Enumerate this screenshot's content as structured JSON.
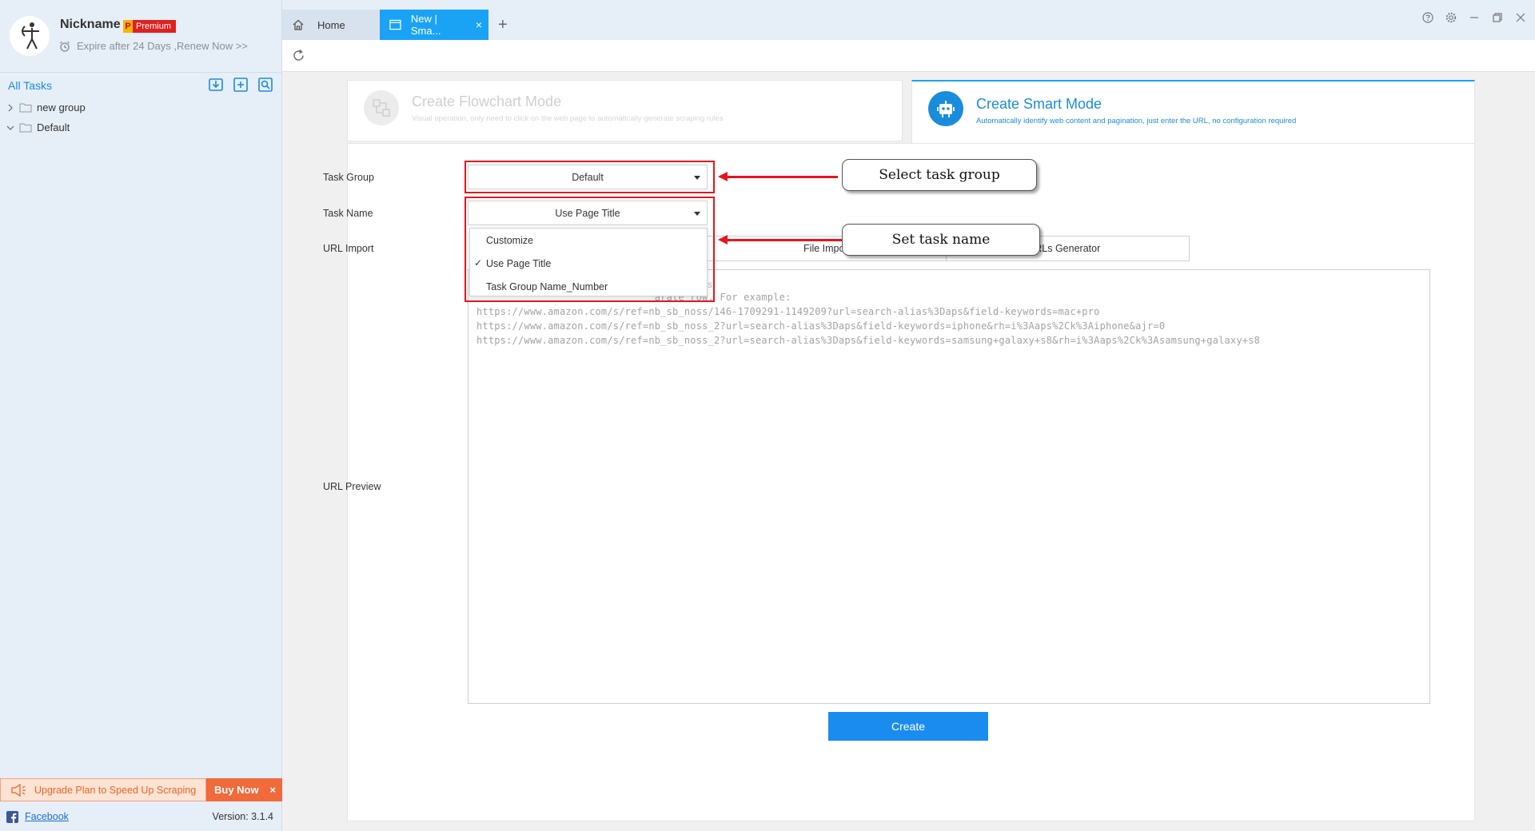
{
  "profile": {
    "nickname": "Nickname",
    "badge_letter": "P",
    "badge_text": "Premium",
    "expire_text": "Expire after 24 Days ,Renew Now >>"
  },
  "sidebar": {
    "all_tasks": "All Tasks",
    "tree": [
      {
        "label": "new group",
        "expanded": false
      },
      {
        "label": "Default",
        "expanded": true
      }
    ],
    "upgrade_text": "Upgrade Plan to Speed Up Scraping",
    "buy_now": "Buy Now",
    "facebook": "Facebook",
    "version": "Version: 3.1.4"
  },
  "tabs": {
    "home": "Home",
    "new": "New | Sma...",
    "close": "×",
    "add": "+"
  },
  "modes": {
    "flowchart": {
      "title": "Create Flowchart Mode",
      "desc": "Visual operation, only need to click on the web page to automatically generate scraping rules"
    },
    "smart": {
      "title": "Create Smart Mode",
      "desc": "Automatically identify web content and pagination, just enter the URL, no configuration required"
    }
  },
  "form": {
    "task_group_label": "Task Group",
    "task_group_value": "Default",
    "task_name_label": "Task Name",
    "task_name_value": "Use Page Title",
    "url_import_label": "URL Import",
    "url_preview_label": "URL Preview",
    "dropdown_options": [
      "Customize",
      "Use Page Title",
      "Task Group Name_Number"
    ],
    "selected_option": "Use Page Title",
    "check_mark": "✓",
    "import_tabs": [
      "File Impo",
      "RLs Generator"
    ],
    "dropdown_obscured_suffix": "s",
    "textarea_lines": [
      "                              arate row, For example:",
      "https://www.amazon.com/s/ref=nb_sb_noss/146-1709291-1149209?url=search-alias%3Daps&field-keywords=mac+pro",
      "https://www.amazon.com/s/ref=nb_sb_noss_2?url=search-alias%3Daps&field-keywords=iphone&rh=i%3Aaps%2Ck%3Aiphone&ajr=0",
      "https://www.amazon.com/s/ref=nb_sb_noss_2?url=search-alias%3Daps&field-keywords=samsung+galaxy+s8&rh=i%3Aaps%2Ck%3Asamsung+galaxy+s8"
    ],
    "create_button": "Create"
  },
  "callouts": {
    "select_task_group": "Select task group",
    "set_task_name": "Set task name"
  },
  "colors": {
    "accent": "#1a8cdc",
    "tab_active": "#1aa3f5",
    "highlight": "#e8141c",
    "buy_now": "#f06a3a"
  }
}
